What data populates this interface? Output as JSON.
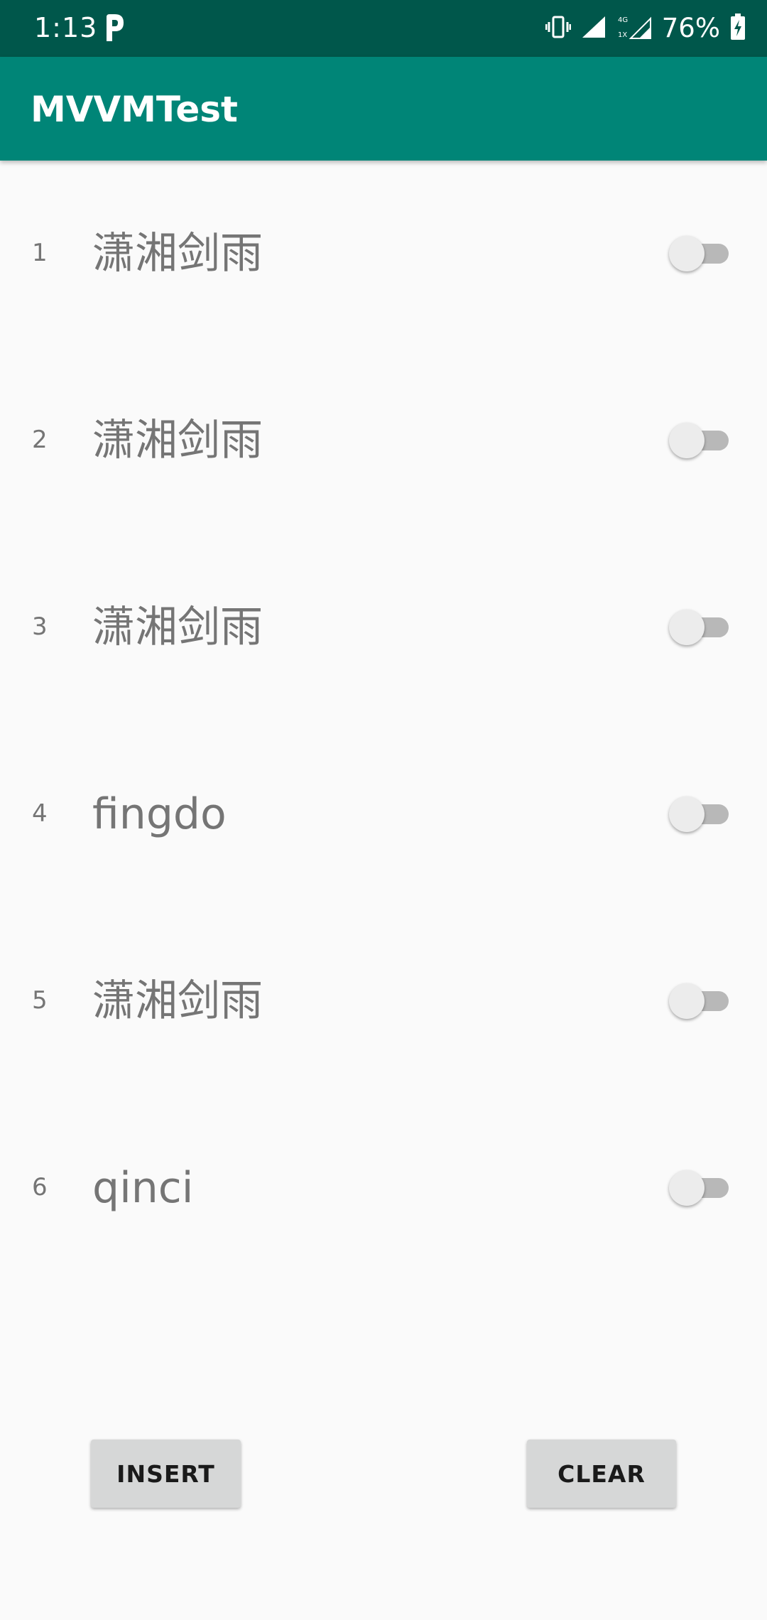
{
  "status_bar": {
    "time": "1:13",
    "battery_percent": "76%",
    "icons": [
      "parking-icon",
      "vibrate-icon",
      "signal-icon",
      "signal-4g-icon",
      "battery-charging-icon"
    ]
  },
  "app_bar": {
    "title": "MVVMTest"
  },
  "list": {
    "items": [
      {
        "index": "1",
        "name": "潇湘剑雨",
        "checked": false
      },
      {
        "index": "2",
        "name": "潇湘剑雨",
        "checked": false
      },
      {
        "index": "3",
        "name": "潇湘剑雨",
        "checked": false
      },
      {
        "index": "4",
        "name": "fingdo",
        "checked": false
      },
      {
        "index": "5",
        "name": "潇湘剑雨",
        "checked": false
      },
      {
        "index": "6",
        "name": "qinci",
        "checked": false
      }
    ]
  },
  "buttons": {
    "insert_label": "INSERT",
    "clear_label": "CLEAR"
  },
  "colors": {
    "status_bar": "#00574b",
    "app_bar": "#008577",
    "background": "#fafafa",
    "button": "#d6d7d7"
  }
}
